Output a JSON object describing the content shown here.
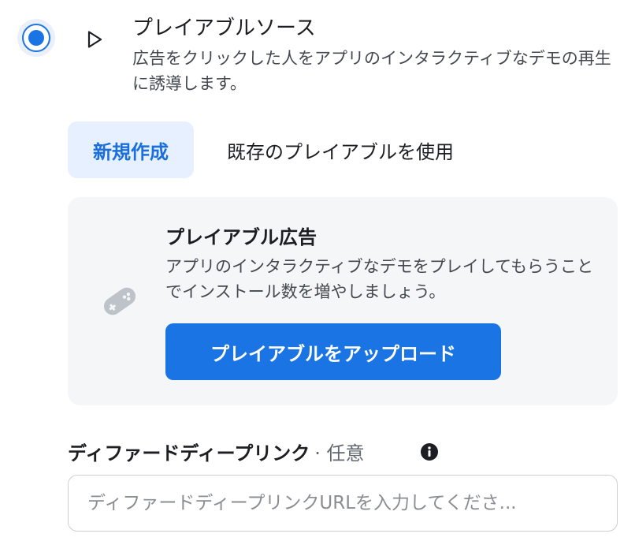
{
  "option": {
    "selected": true,
    "title": "プレイアブルソース",
    "description": "広告をクリックした人をアプリのインタラクティブなデモの再生に誘導します。",
    "icon": "play-icon"
  },
  "tabs": [
    {
      "label": "新規作成",
      "active": true
    },
    {
      "label": "既存のプレイアブルを使用",
      "active": false
    }
  ],
  "card": {
    "icon": "gamepad-icon",
    "title": "プレイアブル広告",
    "description": "アプリのインタラクティブなデモをプレイしてもらうことでインストール数を増やしましょう。",
    "button_label": "プレイアブルをアップロード"
  },
  "deeplink": {
    "label": "ディファードディープリンク",
    "optional": "· 任意",
    "info_icon": "info-icon",
    "value": "",
    "placeholder": "ディファードディープリンクURLを入力してくださ..."
  },
  "colors": {
    "accent": "#1b74e4",
    "tab_active_bg": "#e7f0fe",
    "card_bg": "#f5f6f7",
    "text_primary": "#1c1e21",
    "text_secondary": "#444950"
  }
}
